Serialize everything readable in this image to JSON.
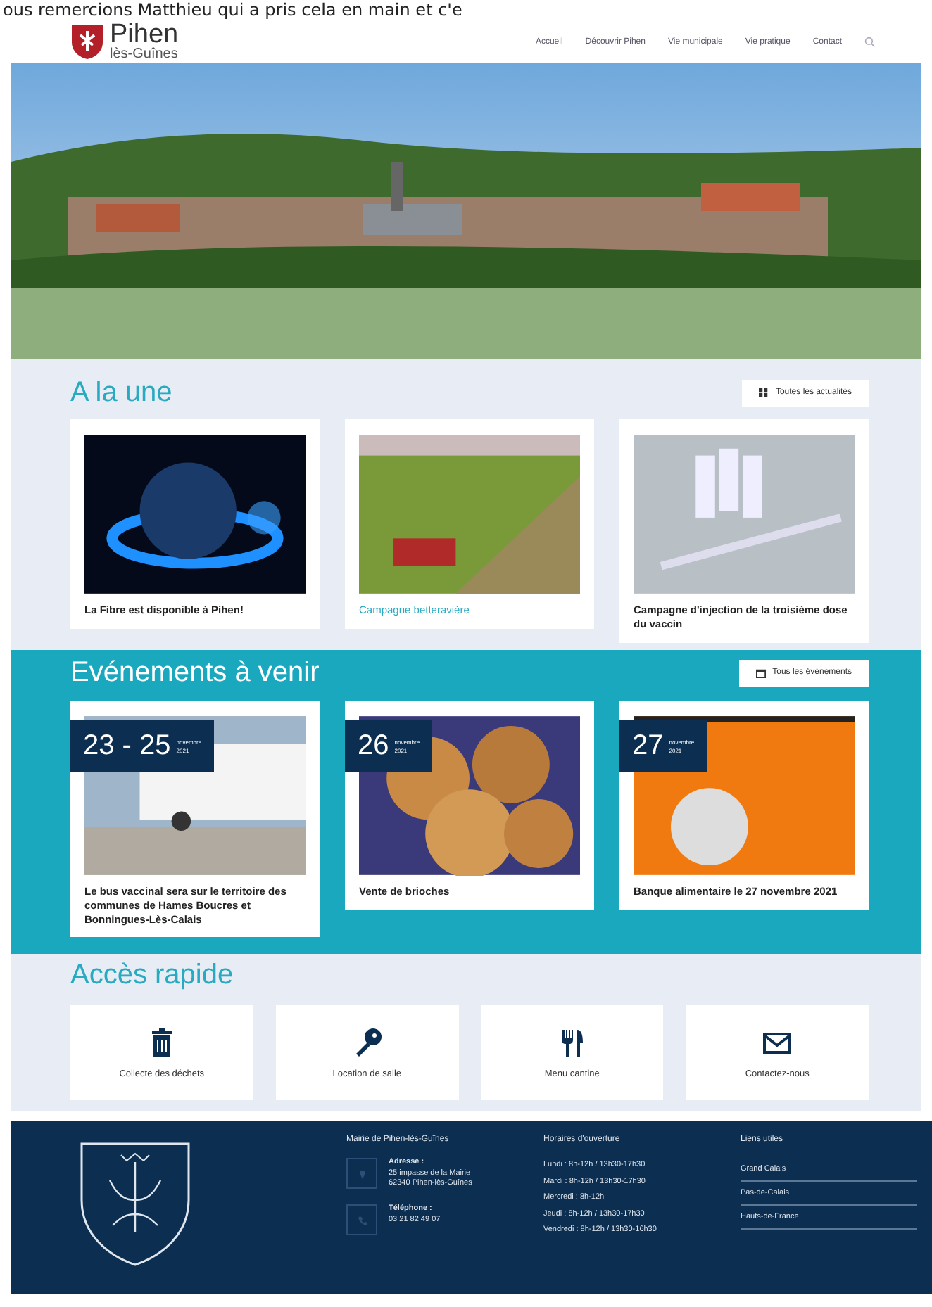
{
  "top_text": "ous remercions Matthieu qui a pris cela en main et c'e",
  "header": {
    "logo_title": "Pihen",
    "logo_subtitle": "lès-Guînes",
    "nav": [
      {
        "label": "Accueil",
        "selected": false
      },
      {
        "label": "Découvrir Pihen",
        "selected": false
      },
      {
        "label": "Vie municipale",
        "selected": false
      },
      {
        "label": "Vie pratique",
        "selected": false
      },
      {
        "label": "Contact",
        "selected": false
      }
    ]
  },
  "news": {
    "title": "A la une",
    "all_button": "Toutes les actualités",
    "items": [
      {
        "title": "La Fibre est disponible à Pihen!",
        "highlighted": false
      },
      {
        "title": "Campagne betteravière",
        "highlighted": true
      },
      {
        "title": "Campagne d'injection de la troisième dose du vaccin",
        "highlighted": false
      }
    ]
  },
  "events": {
    "title": "Evénements à venir",
    "all_button": "Tous les événements",
    "items": [
      {
        "day": "23 - 25",
        "month": "novembre",
        "year": "2021",
        "title": "Le bus vaccinal sera sur le territoire des communes de Hames Boucres et Bonningues-Lès-Calais"
      },
      {
        "day": "26",
        "month": "novembre",
        "year": "2021",
        "title": "Vente de brioches"
      },
      {
        "day": "27",
        "month": "novembre",
        "year": "2021",
        "title": "Banque alimentaire le 27 novembre 2021"
      }
    ]
  },
  "quick_access": {
    "title": "Accès rapide",
    "items": [
      {
        "label": "Collecte des déchets",
        "kind": "trash"
      },
      {
        "label": "Location de salle",
        "kind": "key"
      },
      {
        "label": "Menu cantine",
        "kind": "cutlery"
      },
      {
        "label": "Contactez-nous",
        "kind": "mail"
      }
    ]
  },
  "footer": {
    "mairie": {
      "title": "Mairie de Pihen-lès-Guînes",
      "contacts": [
        {
          "kind": "address",
          "label": "Adresse :",
          "lines": [
            "25 impasse de la Mairie",
            "62340 Pihen-lès-Guînes"
          ]
        },
        {
          "kind": "phone",
          "label": "Téléphone :",
          "lines": [
            "03 21 82 49 07"
          ]
        }
      ]
    },
    "hours": {
      "title": "Horaires d'ouverture",
      "lines": [
        "Lundi : 8h-12h / 13h30-17h30",
        "Mardi : 8h-12h / 13h30-17h30",
        "Mercredi : 8h-12h",
        "Jeudi : 8h-12h / 13h30-17h30",
        "Vendredi : 8h-12h / 13h30-16h30"
      ]
    },
    "links": {
      "title": "Liens utiles",
      "items": [
        "Grand Calais",
        "Pas-de-Calais",
        "Hauts-de-France"
      ]
    }
  }
}
